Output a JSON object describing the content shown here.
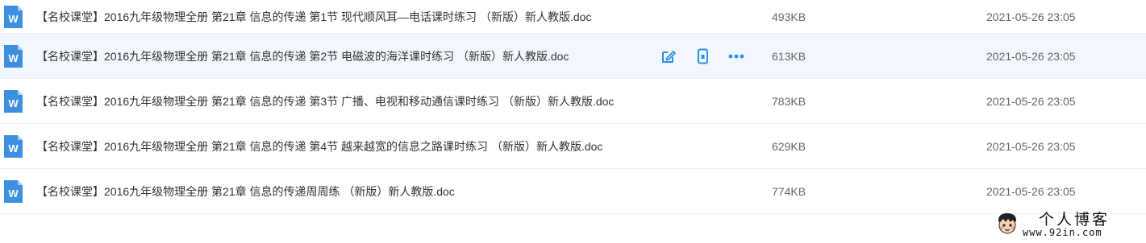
{
  "files": [
    {
      "name": "【名校课堂】2016九年级物理全册 第21章 信息的传递 第1节 现代顺风耳—电话课时练习 （新版）新人教版.doc",
      "size": "493KB",
      "date": "2021-05-26 23:05",
      "icon": "word-doc-icon"
    },
    {
      "name": "【名校课堂】2016九年级物理全册 第21章 信息的传递 第2节 电磁波的海洋课时练习 （新版）新人教版.doc",
      "size": "613KB",
      "date": "2021-05-26 23:05",
      "icon": "word-doc-icon"
    },
    {
      "name": "【名校课堂】2016九年级物理全册 第21章 信息的传递 第3节 广播、电视和移动通信课时练习 （新版）新人教版.doc",
      "size": "783KB",
      "date": "2021-05-26 23:05",
      "icon": "word-doc-icon"
    },
    {
      "name": "【名校课堂】2016九年级物理全册 第21章 信息的传递 第4节 越来越宽的信息之路课时练习 （新版）新人教版.doc",
      "size": "629KB",
      "date": "2021-05-26 23:05",
      "icon": "word-doc-icon"
    },
    {
      "name": "【名校课堂】2016九年级物理全册 第21章 信息的传递周周练 （新版）新人教版.doc",
      "size": "774KB",
      "date": "2021-05-26 23:05",
      "icon": "word-doc-icon"
    }
  ],
  "row_actions": [
    "edit-icon",
    "mobile-icon",
    "more-icon"
  ],
  "watermark": {
    "title": "个人博客",
    "url": "www.92in.com"
  },
  "colors": {
    "accent": "#2b8ee8",
    "word_icon": "#3d8fe0",
    "hover_row": "#f2f7fd"
  }
}
